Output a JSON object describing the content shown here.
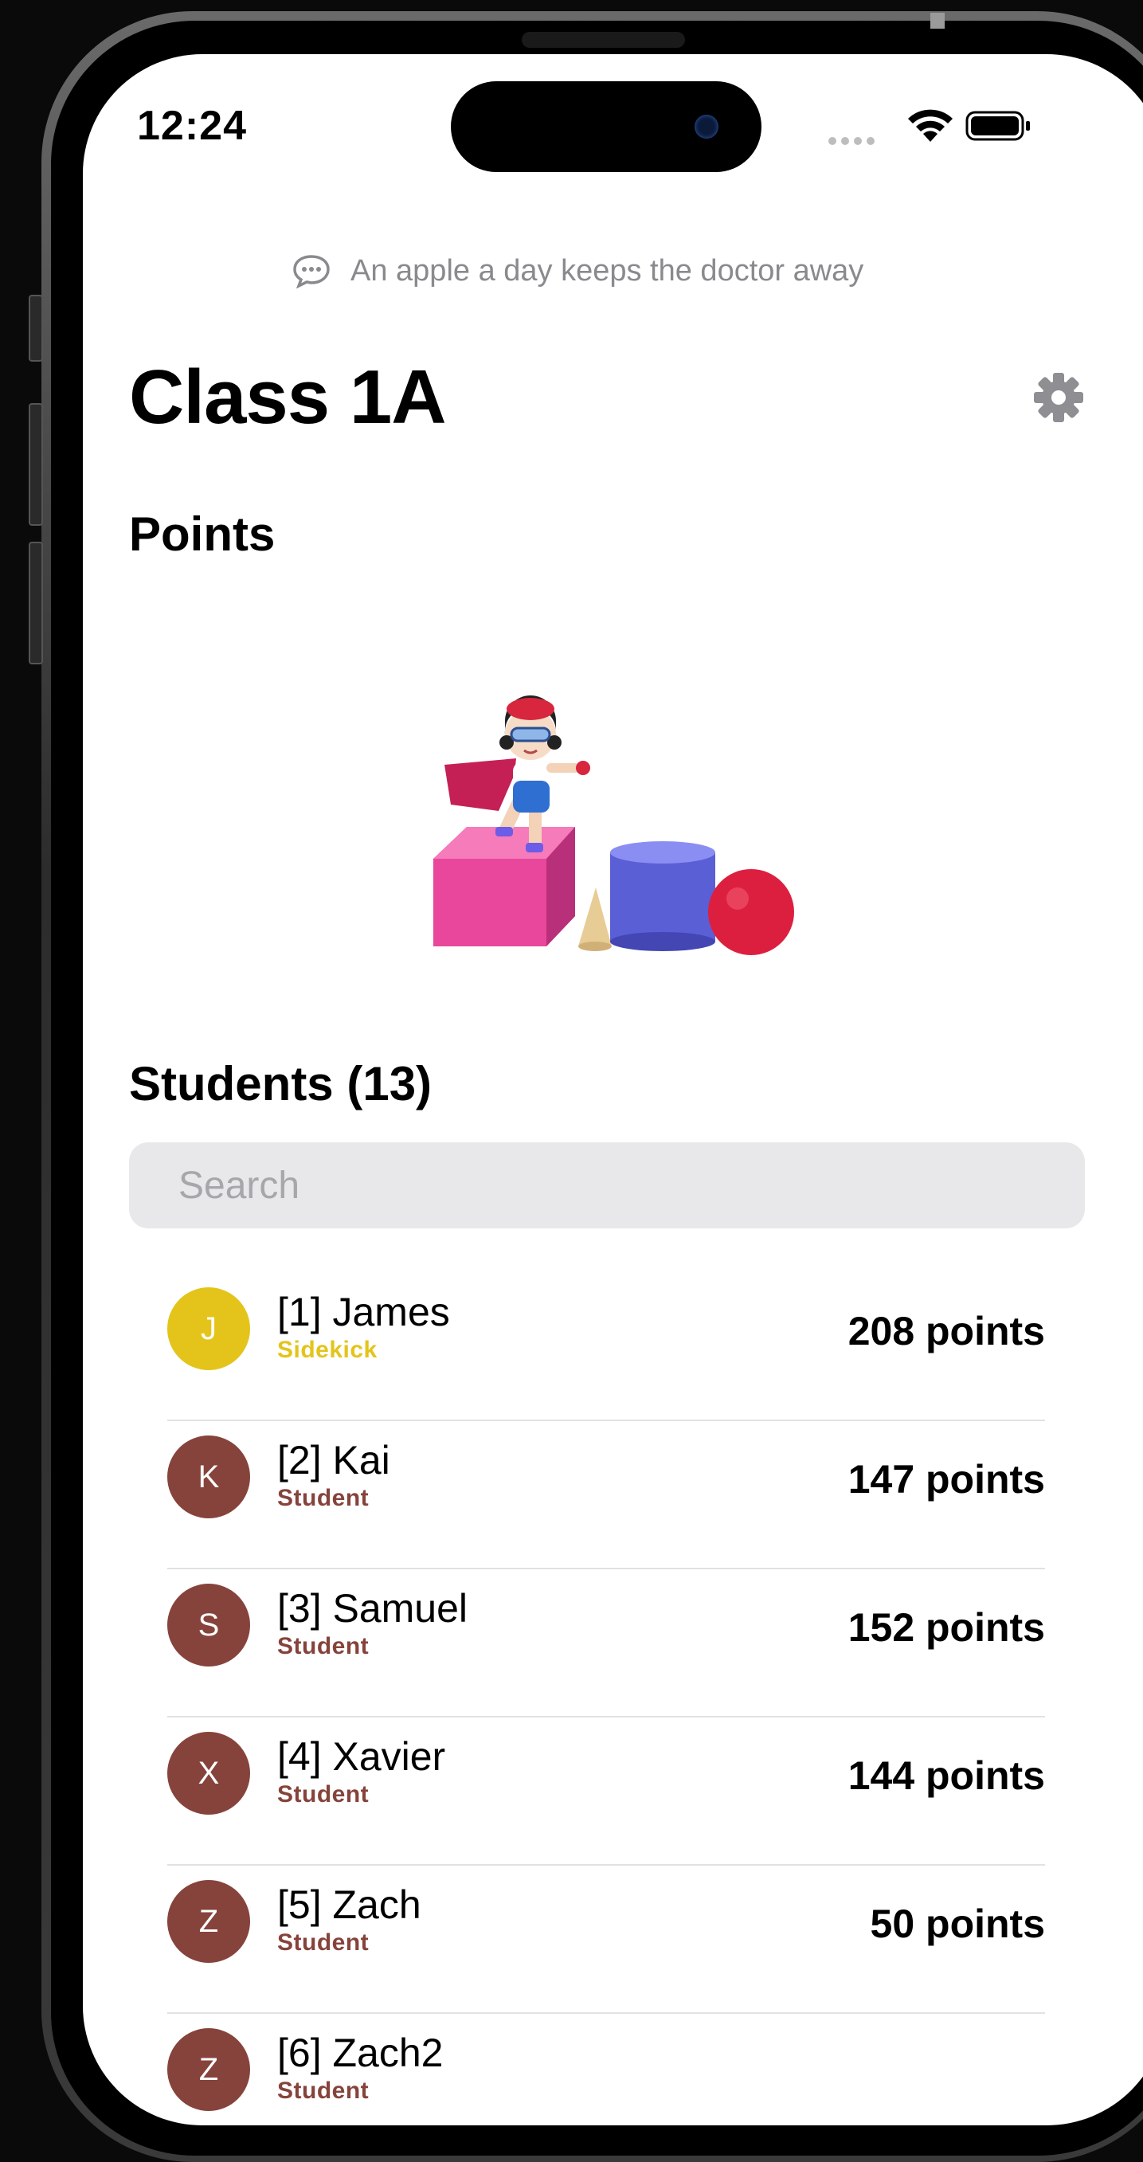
{
  "status_bar": {
    "time": "12:24"
  },
  "quote": "An apple a day keeps the doctor away",
  "page_title": "Class 1A",
  "points_section": {
    "title": "Points"
  },
  "students_section": {
    "title": "Students (13)"
  },
  "search": {
    "placeholder": "Search"
  },
  "colors": {
    "gold": "#e4c41a",
    "maroon": "#86433b",
    "screen_bg": "#ffffff"
  },
  "students": [
    {
      "initial": "J",
      "name": "[1] James",
      "role": "Sidekick",
      "points": "208 points",
      "color": "#e4c41a"
    },
    {
      "initial": "K",
      "name": "[2] Kai",
      "role": "Student",
      "points": "147 points",
      "color": "#86433b"
    },
    {
      "initial": "S",
      "name": "[3] Samuel",
      "role": "Student",
      "points": "152 points",
      "color": "#86433b"
    },
    {
      "initial": "X",
      "name": "[4] Xavier",
      "role": "Student",
      "points": "144 points",
      "color": "#86433b"
    },
    {
      "initial": "Z",
      "name": "[5] Zach",
      "role": "Student",
      "points": "50 points",
      "color": "#86433b"
    },
    {
      "initial": "Z",
      "name": "[6] Zach2",
      "role": "Student",
      "points": "",
      "color": "#86433b"
    }
  ],
  "icons": {
    "quote": "speech-bubble-icon",
    "settings": "gear-icon",
    "wifi": "wifi-icon",
    "battery": "battery-icon"
  }
}
